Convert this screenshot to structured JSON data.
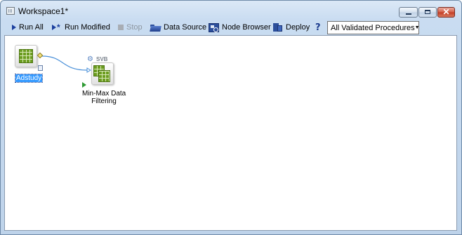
{
  "window": {
    "title": "Workspace1*",
    "controls": {
      "minimize": "",
      "maximize": "",
      "close": "✕"
    }
  },
  "toolbar": {
    "run_all": "Run All",
    "run_modified": "Run Modified",
    "stop": "Stop",
    "data_source": "Data Source",
    "node_browser": "Node Browser",
    "deploy": "Deploy",
    "help": "?",
    "procedures_dropdown": {
      "value": "All Validated Procedures",
      "arrow": "▼"
    }
  },
  "canvas": {
    "nodes": [
      {
        "label": "Adstudy",
        "selected": true,
        "icon": "data-table-icon"
      },
      {
        "label_line1": "Min-Max Data",
        "label_line2": "Filtering",
        "badge": "SVB",
        "icon": "data-filter-icon"
      }
    ]
  },
  "colors": {
    "accent_blue": "#1b3f9e",
    "node_green": "#6b9c1f",
    "selection": "#3399ff",
    "connector": "#4a90d9"
  }
}
